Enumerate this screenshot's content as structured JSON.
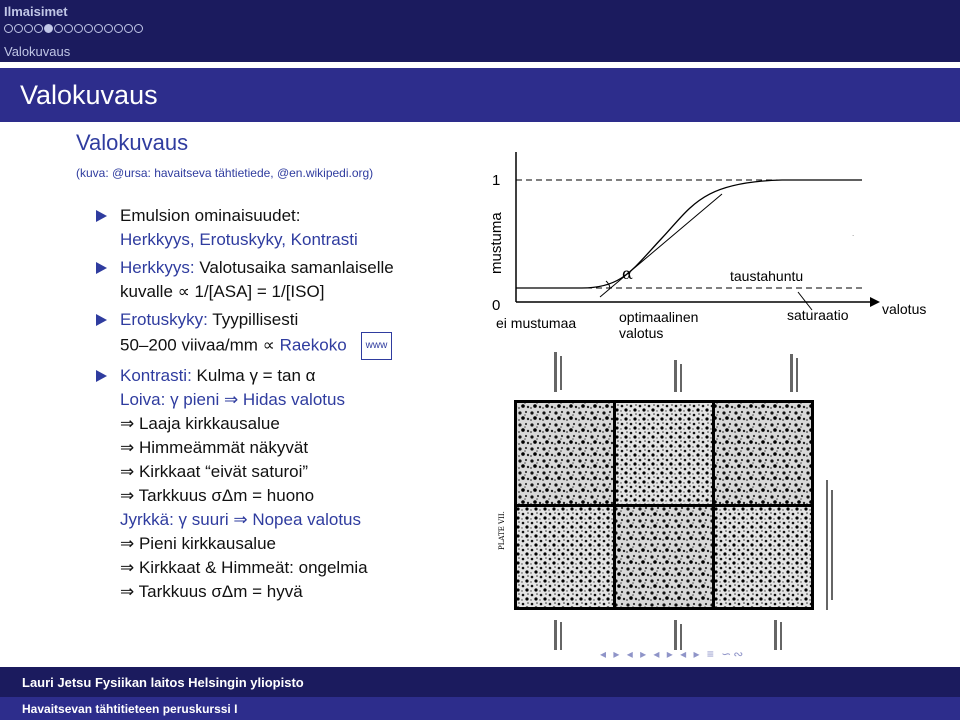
{
  "header": {
    "section": "Ilmaisimet",
    "subsection": "Valokuvaus",
    "nav_dots": [
      false,
      false,
      false,
      false,
      true,
      false,
      false,
      false,
      false,
      false,
      false,
      false,
      false,
      false
    ]
  },
  "title": "Valokuvaus",
  "subtitle": "Valokuvaus",
  "source": "(kuva: @ursa: havaitseva tähtietiede, @en.wikipedi.org)",
  "items": [
    {
      "lines": [
        "Emulsion ominaisuudet:",
        "Herkkyys, Erotuskyky, Kontrasti"
      ]
    },
    {
      "label": "Herkkyys:",
      "lines": [
        "Valotusaika samanlaiselle",
        "kuvalle ∝ 1/[ASA] = 1/[ISO]"
      ]
    },
    {
      "label": "Erotuskyky:",
      "lines": [
        "Tyypillisesti",
        "50–200 viivaa/mm ∝"
      ],
      "link": "Raekoko",
      "www": "www"
    },
    {
      "label": "Kontrasti:",
      "lines": [
        "Kulma γ = tan α",
        "Loiva: γ pieni ⇒ Hidas valotus",
        "⇒ Laaja kirkkausalue",
        "⇒ Himmeämmät näkyvät",
        "⇒ Kirkkaat “eivät saturoi”",
        "⇒ Tarkkuus σΔm = huono",
        "Jyrkkä: γ suuri ⇒ Nopea valotus",
        "⇒ Pieni kirkkausalue",
        "⇒ Kirkkaat & Himmeät: ongelmia",
        "⇒ Tarkkuus σΔm = hyvä"
      ]
    }
  ],
  "curve": {
    "y_top": "1",
    "y_zero": "0",
    "y_label": "mustuma",
    "alpha": "α",
    "fog": "taustahuntu",
    "x_label": "valotus",
    "left_label": "ei mustumaa",
    "mid_label_1": "optimaalinen",
    "mid_label_2": "valotus",
    "right_label": "saturaatio"
  },
  "plate": {
    "side_label": "PLATE VII."
  },
  "footer": {
    "author": "Lauri Jetsu  Fysiikan laitos  Helsingin yliopisto",
    "course": "Havaitsevan tähtitieteen peruskurssi I"
  },
  "colors": {
    "header_bg": "#1b1b5e",
    "title_bg": "#2d2d8c",
    "accent": "#2f3c9f"
  }
}
